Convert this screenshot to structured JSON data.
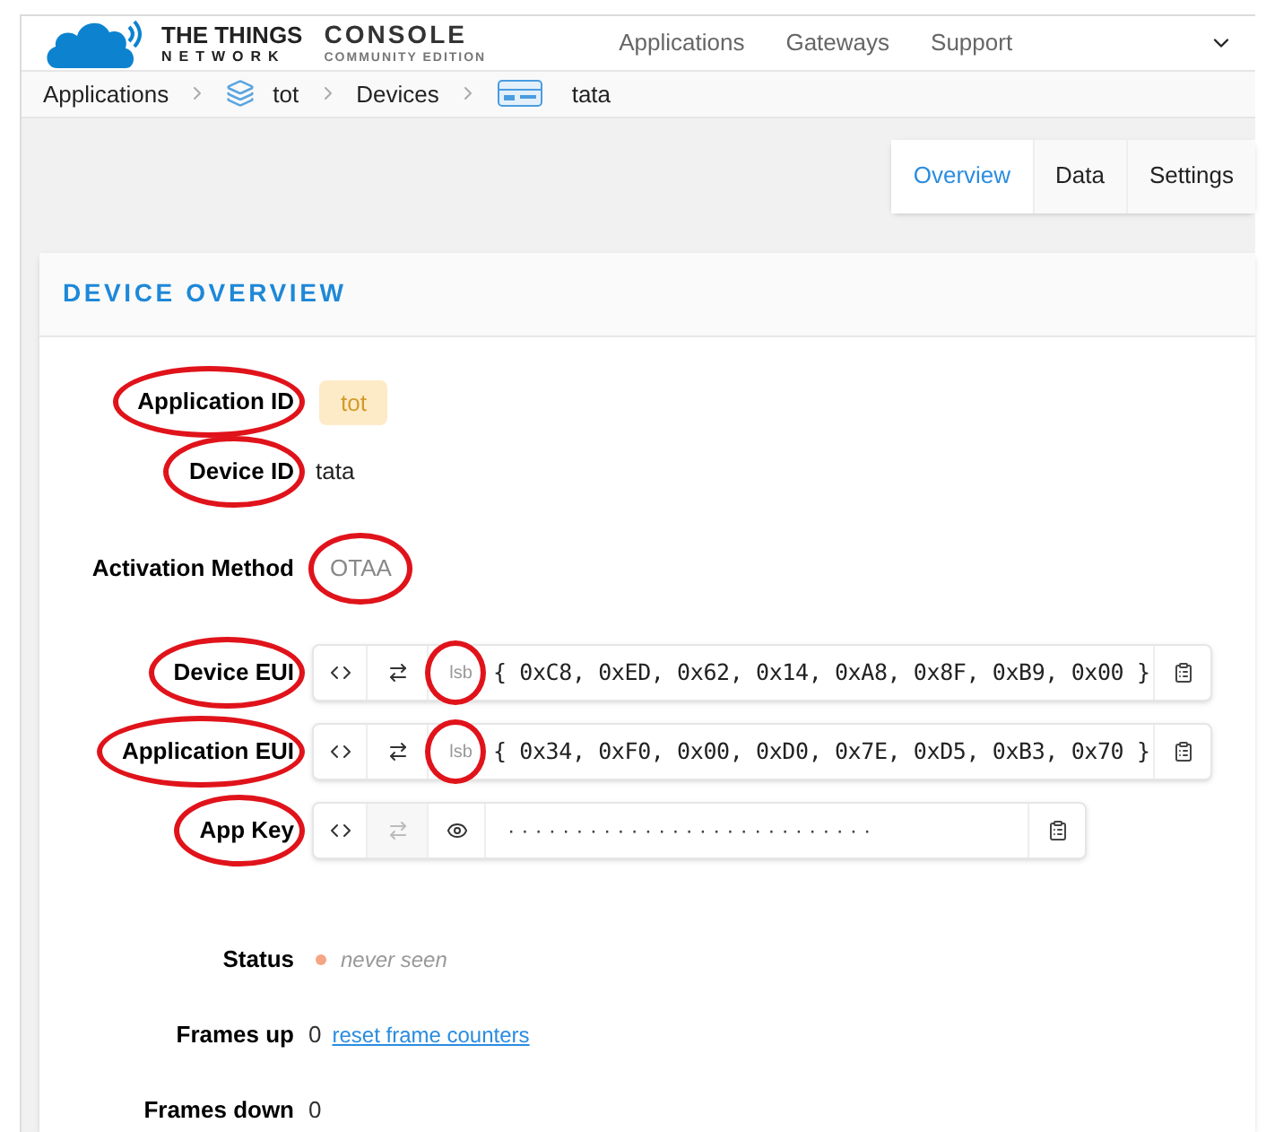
{
  "header": {
    "brand_top": "THE THINGS",
    "brand_bottom": "NETWORK",
    "product": "CONSOLE",
    "edition": "COMMUNITY EDITION",
    "nav": [
      "Applications",
      "Gateways",
      "Support"
    ]
  },
  "breadcrumb": [
    {
      "label": "Applications",
      "kind": "text"
    },
    {
      "label": "tot",
      "kind": "app"
    },
    {
      "label": "Devices",
      "kind": "text"
    },
    {
      "label": "tata",
      "kind": "device"
    }
  ],
  "tabs": [
    {
      "label": "Overview",
      "selected": true
    },
    {
      "label": "Data",
      "selected": false
    },
    {
      "label": "Settings",
      "selected": false
    }
  ],
  "card": {
    "title": "DEVICE OVERVIEW",
    "fields": [
      {
        "kind": "badge",
        "label": "Application ID",
        "circled": true,
        "value": "tot"
      },
      {
        "kind": "text",
        "label": "Device ID",
        "circled": true,
        "value": "tata"
      },
      {
        "kind": "method",
        "label": "Activation Method",
        "value": "OTAA",
        "value_circled": true
      },
      {
        "kind": "eui",
        "label": "Device EUI",
        "circled": true,
        "order": "lsb",
        "order_circled": true,
        "value": "{ 0xC8, 0xED, 0x62, 0x14, 0xA8, 0x8F, 0xB9, 0x00 }"
      },
      {
        "kind": "eui",
        "label": "Application EUI",
        "circled": true,
        "order": "lsb",
        "order_circled": true,
        "value": "{ 0x34, 0xF0, 0x00, 0xD0, 0x7E, 0xD5, 0xB3, 0x70 }"
      },
      {
        "kind": "key",
        "label": "App Key",
        "circled": true,
        "value": "· · · · · · · · · · · · · · · · · · · · · · · · · · ·"
      },
      {
        "kind": "status",
        "label": "Status",
        "value": "never seen",
        "color": "#f4a582"
      },
      {
        "kind": "counter",
        "label": "Frames up",
        "value": "0",
        "link": "reset frame counters"
      },
      {
        "kind": "counter",
        "label": "Frames down",
        "value": "0"
      }
    ]
  }
}
